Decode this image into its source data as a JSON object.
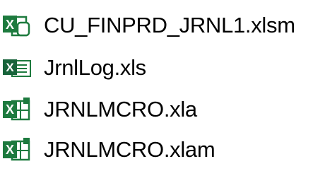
{
  "files": [
    {
      "name": "CU_FINPRD_JRNL1.xlsm",
      "icon": "excel-macro-enabled-workbook-icon"
    },
    {
      "name": "JrnlLog.xls",
      "icon": "excel-97-2003-workbook-icon"
    },
    {
      "name": "JRNLMCRO.xla",
      "icon": "excel-addin-icon"
    },
    {
      "name": "JRNLMCRO.xlam",
      "icon": "excel-addin-icon"
    }
  ],
  "colors": {
    "excel_green": "#1d7a3e",
    "excel_dark_green": "#17633a",
    "text": "#000000"
  }
}
